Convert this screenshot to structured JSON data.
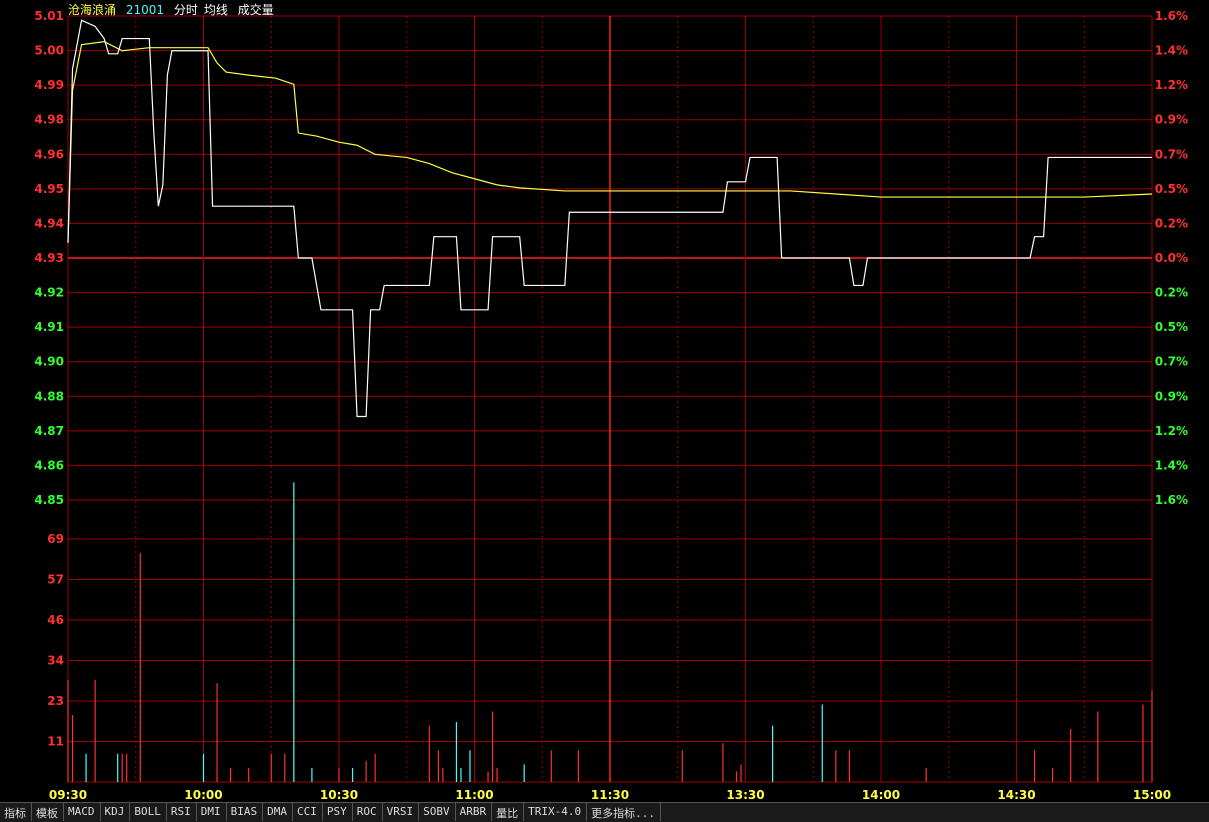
{
  "header": {
    "name": "沧海浪涌",
    "code": "21001",
    "view": "分时",
    "avg_label": "均线",
    "vol_label": "成交量"
  },
  "colors": {
    "background": "#000000",
    "grid": "#a00000",
    "grid_mid": "#ff2020",
    "price_line": "#ffffff",
    "avg_line": "#ffff40",
    "up": "#ff3030",
    "down": "#30ff30",
    "vol_up": "#ff3030",
    "vol_down": "#40ffff",
    "header_name": "#ffff40",
    "header_code": "#40ffff",
    "header_text": "#ffffff",
    "time_label": "#ffff40"
  },
  "chart_data": {
    "type": "line",
    "price_axis": {
      "ticks": [
        "5.01",
        "5.00",
        "4.99",
        "4.98",
        "4.96",
        "4.95",
        "4.94",
        "4.93",
        "4.92",
        "4.91",
        "4.90",
        "4.88",
        "4.87",
        "4.86",
        "4.85"
      ],
      "pct": [
        "1.6%",
        "1.4%",
        "1.2%",
        "0.9%",
        "0.7%",
        "0.5%",
        "0.2%",
        "0.0%",
        "0.2%",
        "0.5%",
        "0.7%",
        "0.9%",
        "1.2%",
        "1.4%",
        "1.6%"
      ],
      "reference": 4.93,
      "ylim": [
        4.8506,
        5.0094
      ]
    },
    "volume_axis": {
      "ticks": [
        "69",
        "57",
        "46",
        "34",
        "23",
        "11"
      ],
      "ylim": [
        0,
        80
      ]
    },
    "time_axis": {
      "labels": [
        "09:30",
        "10:00",
        "10:30",
        "11:00",
        "11:30",
        "13:30",
        "14:00",
        "14:30",
        "15:00"
      ]
    },
    "price": [
      [
        0,
        4.935
      ],
      [
        1,
        4.992
      ],
      [
        3,
        5.008
      ],
      [
        6,
        5.006
      ],
      [
        8,
        5.002
      ],
      [
        9,
        4.997
      ],
      [
        11,
        4.997
      ],
      [
        12,
        5.002
      ],
      [
        18,
        5.002
      ],
      [
        19,
        4.971
      ],
      [
        20,
        4.947
      ],
      [
        21,
        4.954
      ],
      [
        22,
        4.99
      ],
      [
        23,
        4.998
      ],
      [
        30,
        4.998
      ],
      [
        31,
        4.998
      ],
      [
        32,
        4.947
      ],
      [
        50,
        4.947
      ],
      [
        51,
        4.93
      ],
      [
        54,
        4.93
      ],
      [
        56,
        4.913
      ],
      [
        63,
        4.913
      ],
      [
        64,
        4.878
      ],
      [
        66,
        4.878
      ],
      [
        67,
        4.913
      ],
      [
        69,
        4.913
      ],
      [
        70,
        4.921
      ],
      [
        80,
        4.921
      ],
      [
        81,
        4.937
      ],
      [
        86,
        4.937
      ],
      [
        87,
        4.913
      ],
      [
        93,
        4.913
      ],
      [
        94,
        4.937
      ],
      [
        100,
        4.937
      ],
      [
        101,
        4.921
      ],
      [
        110,
        4.921
      ],
      [
        111,
        4.945
      ],
      [
        145,
        4.945
      ],
      [
        146,
        4.955
      ],
      [
        150,
        4.955
      ],
      [
        151,
        4.963
      ],
      [
        157,
        4.963
      ],
      [
        158,
        4.93
      ],
      [
        173,
        4.93
      ],
      [
        174,
        4.921
      ],
      [
        176,
        4.921
      ],
      [
        177,
        4.93
      ],
      [
        213,
        4.93
      ],
      [
        214,
        4.937
      ],
      [
        216,
        4.937
      ],
      [
        217,
        4.963
      ],
      [
        240,
        4.963
      ]
    ],
    "avg": [
      [
        0,
        4.935
      ],
      [
        1,
        4.985
      ],
      [
        3,
        5.0
      ],
      [
        8,
        5.001
      ],
      [
        12,
        4.998
      ],
      [
        18,
        4.999
      ],
      [
        31,
        4.999
      ],
      [
        33,
        4.994
      ],
      [
        35,
        4.991
      ],
      [
        40,
        4.99
      ],
      [
        46,
        4.989
      ],
      [
        50,
        4.987
      ],
      [
        51,
        4.971
      ],
      [
        55,
        4.97
      ],
      [
        60,
        4.968
      ],
      [
        64,
        4.967
      ],
      [
        68,
        4.964
      ],
      [
        75,
        4.963
      ],
      [
        80,
        4.961
      ],
      [
        85,
        4.958
      ],
      [
        90,
        4.956
      ],
      [
        95,
        4.954
      ],
      [
        100,
        4.953
      ],
      [
        110,
        4.952
      ],
      [
        140,
        4.952
      ],
      [
        160,
        4.952
      ],
      [
        170,
        4.951
      ],
      [
        180,
        4.95
      ],
      [
        200,
        4.95
      ],
      [
        215,
        4.95
      ],
      [
        225,
        4.95
      ],
      [
        240,
        4.951
      ]
    ],
    "volume": [
      [
        0,
        29,
        "up"
      ],
      [
        1,
        19,
        "up"
      ],
      [
        4,
        8,
        "down"
      ],
      [
        6,
        29,
        "up"
      ],
      [
        11,
        8,
        "down"
      ],
      [
        12,
        8,
        "up"
      ],
      [
        13,
        8,
        "up"
      ],
      [
        16,
        65,
        "up"
      ],
      [
        30,
        8,
        "down"
      ],
      [
        33,
        28,
        "up"
      ],
      [
        36,
        4,
        "up"
      ],
      [
        40,
        4,
        "up"
      ],
      [
        45,
        8,
        "up"
      ],
      [
        48,
        8,
        "up"
      ],
      [
        50,
        85,
        "down"
      ],
      [
        54,
        4,
        "down"
      ],
      [
        60,
        4,
        "up"
      ],
      [
        63,
        4,
        "down"
      ],
      [
        66,
        6,
        "up"
      ],
      [
        68,
        8,
        "up"
      ],
      [
        80,
        16,
        "up"
      ],
      [
        82,
        9,
        "up"
      ],
      [
        83,
        4,
        "up"
      ],
      [
        86,
        17,
        "down"
      ],
      [
        87,
        4,
        "down"
      ],
      [
        89,
        9,
        "down"
      ],
      [
        93,
        3,
        "up"
      ],
      [
        94,
        20,
        "up"
      ],
      [
        95,
        4,
        "up"
      ],
      [
        101,
        5,
        "down"
      ],
      [
        107,
        9,
        "up"
      ],
      [
        113,
        9,
        "up"
      ],
      [
        136,
        9,
        "up"
      ],
      [
        145,
        11,
        "up"
      ],
      [
        148,
        3,
        "up"
      ],
      [
        149,
        5,
        "up"
      ],
      [
        156,
        16,
        "down"
      ],
      [
        167,
        22,
        "down"
      ],
      [
        170,
        9,
        "up"
      ],
      [
        173,
        9,
        "up"
      ],
      [
        190,
        4,
        "up"
      ],
      [
        214,
        9,
        "up"
      ],
      [
        218,
        4,
        "up"
      ],
      [
        222,
        15,
        "up"
      ],
      [
        228,
        20,
        "up"
      ],
      [
        238,
        22,
        "up"
      ],
      [
        240,
        26,
        "up"
      ]
    ]
  },
  "tabs": [
    "指标",
    "模板",
    "MACD",
    "KDJ",
    "BOLL",
    "RSI",
    "DMI",
    "BIAS",
    "DMA",
    "CCI",
    "PSY",
    "ROC",
    "VRSI",
    "SOBV",
    "ARBR",
    "量比",
    "TRIX-4.0",
    "更多指标..."
  ]
}
